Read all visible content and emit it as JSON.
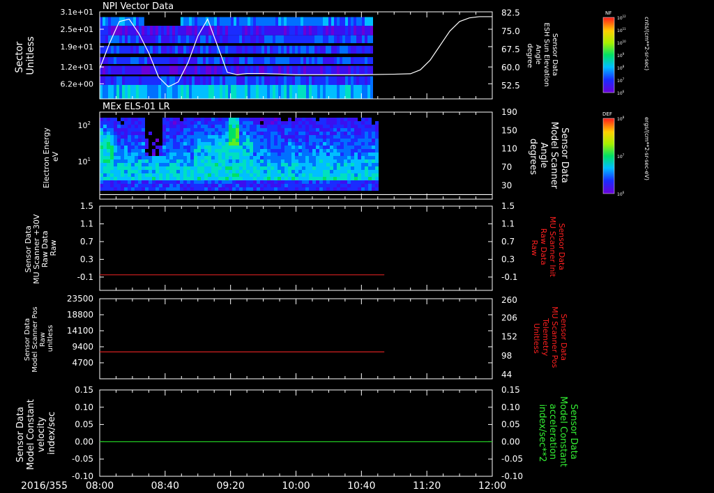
{
  "colors": {
    "background": "#000000",
    "frame": "#ffffff",
    "red_trace": "#d42020",
    "green_trace": "#22cc22",
    "left_label_red": "#ff2020",
    "right_label_green": "#33ee33"
  },
  "time_axis": {
    "date_label": "2016/355",
    "ticks": [
      "08:00",
      "08:40",
      "09:20",
      "10:00",
      "10:40",
      "11:20",
      "12:00"
    ],
    "range": [
      "08:00",
      "12:00"
    ]
  },
  "chart_data": [
    {
      "type": "heatmap",
      "id": "npi",
      "title": "NPI Vector Data",
      "ylabel": [
        "Sector",
        "Unitless"
      ],
      "yticks": [
        "3.1e+01",
        "2.5e+01",
        "1.9e+01",
        "1.2e+01",
        "6.2e+00"
      ],
      "ylim": [
        1,
        31
      ],
      "right_axis": {
        "label": [
          "Sensor Data",
          "ESH Sun Elevation",
          "Angle",
          "degree"
        ],
        "ticks": [
          "82.5",
          "75.0",
          "67.5",
          "60.0",
          "52.5"
        ],
        "ylim": [
          47,
          83
        ]
      },
      "data_extent": [
        "08:00",
        "10:47"
      ],
      "series": [
        {
          "type": "line",
          "color": "#ffffff",
          "x": [
            "08:00",
            "08:06",
            "08:12",
            "08:18",
            "08:24",
            "08:30",
            "08:36",
            "08:42",
            "08:48",
            "08:54",
            "09:00",
            "09:06",
            "09:12",
            "09:18",
            "09:24",
            "09:30",
            "09:40",
            "10:00",
            "10:20",
            "10:40",
            "11:00",
            "11:10",
            "11:16",
            "11:22",
            "11:28",
            "11:34",
            "11:40",
            "11:46",
            "11:52",
            "12:00"
          ],
          "y": [
            59.5,
            70,
            79,
            80,
            74,
            66,
            56,
            52,
            54,
            62,
            73,
            80,
            69,
            58,
            57,
            57.5,
            57.5,
            57,
            57,
            57,
            57.2,
            57.4,
            59,
            63,
            69,
            75,
            79,
            80.5,
            81,
            81
          ]
        }
      ],
      "colorbar": {
        "label": "NF",
        "unit": "cnts/(cm**2-sr-sec)",
        "ticks": [
          "10^12",
          "10^11",
          "10^10",
          "10^9",
          "10^8",
          "10^7",
          "10^6"
        ]
      }
    },
    {
      "type": "heatmap",
      "id": "els",
      "title": "MEx ELS-01 LR",
      "ylabel": [
        "Electron Energy",
        "eV"
      ],
      "yticks": [
        "10^2",
        "10^1"
      ],
      "scale": "log",
      "right_axis": {
        "label": [
          "Sensor Data",
          "Model Scanner",
          "Angle",
          "degrees"
        ],
        "ticks": [
          "190",
          "150",
          "110",
          "70",
          "30"
        ],
        "ylim": [
          0,
          190
        ]
      },
      "data_extent": [
        "08:00",
        "10:49"
      ],
      "series": [
        {
          "type": "line",
          "color": "#ffffff",
          "x": [
            "08:00",
            "12:00"
          ],
          "y": [
            10,
            10
          ]
        }
      ],
      "colorbar": {
        "label": "DEF",
        "unit": "ergs/(cm**2-sr-sec-eV)",
        "ticks": [
          "10^8",
          "10^7",
          "10^6"
        ]
      }
    },
    {
      "type": "line",
      "id": "mu_raw",
      "ylabel": [
        "Sensor Data",
        "MU Scanner +30V",
        "Raw Data",
        "Raw"
      ],
      "yticks": [
        "1.5",
        "1.1",
        "0.7",
        "0.3",
        "-0.1"
      ],
      "ylim": [
        -0.4,
        1.5
      ],
      "right_axis": {
        "label": [
          "Sensor Data",
          "MU Scanner Init",
          "Raw Data",
          "Raw"
        ],
        "ticks": [
          "1.5",
          "1.1",
          "0.7",
          "0.3",
          "-0.1"
        ]
      },
      "series": [
        {
          "color": "#d42020",
          "x": [
            "08:00",
            "10:54"
          ],
          "y": [
            -0.05,
            -0.05
          ]
        }
      ]
    },
    {
      "type": "line",
      "id": "scanner_pos",
      "ylabel": [
        "Sensor Data",
        "Model Scanner Pos",
        "Raw",
        "unitless"
      ],
      "yticks": [
        "23500",
        "18800",
        "14100",
        "9400",
        "4700"
      ],
      "ylim": [
        0,
        23500
      ],
      "right_axis": {
        "label": [
          "Sensor Data",
          "MU Scanner Pos",
          "Telemetry",
          "Unitless"
        ],
        "ticks": [
          "260",
          "206",
          "152",
          "98",
          "44"
        ]
      },
      "series": [
        {
          "color": "#d42020",
          "x": [
            "08:00",
            "10:54"
          ],
          "y": [
            7900,
            7900
          ]
        }
      ]
    },
    {
      "type": "line",
      "id": "velocity",
      "ylabel": [
        "Sensor Data",
        "Model Constant",
        "velocity",
        "index/sec"
      ],
      "yticks": [
        "0.15",
        "0.10",
        "0.05",
        "0.00",
        "-0.05",
        "-0.10"
      ],
      "ylim": [
        -0.1,
        0.15
      ],
      "right_axis": {
        "label": [
          "Sensor Data",
          "Model Constant",
          "acceleration",
          "index/sec**2"
        ],
        "ticks": [
          "0.15",
          "0.10",
          "0.05",
          "0.00",
          "-0.05",
          "-0.10"
        ]
      },
      "series": [
        {
          "color": "#22cc22",
          "x": [
            "08:00",
            "12:00"
          ],
          "y": [
            0,
            0
          ]
        }
      ]
    }
  ]
}
